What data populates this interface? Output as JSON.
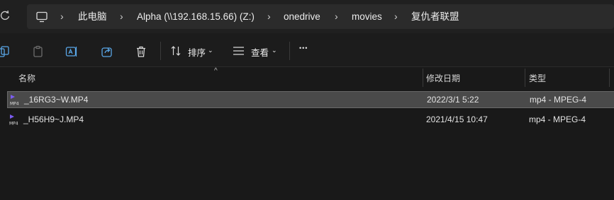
{
  "breadcrumbs": [
    "此电脑",
    "Alpha (\\\\192.168.15.66) (Z:)",
    "onedrive",
    "movies",
    "复仇者联盟"
  ],
  "toolbar": {
    "sort_label": "排序",
    "view_label": "查看",
    "more_label": "•••"
  },
  "columns": {
    "name": "名称",
    "modified": "修改日期",
    "type": "类型"
  },
  "files": [
    {
      "name": "_16RG3~W.MP4",
      "modified": "2022/3/1 5:22",
      "type": "mp4 - MPEG-4",
      "selected": true
    },
    {
      "name": "_H56H9~J.MP4",
      "modified": "2021/4/15 10:47",
      "type": "mp4 - MPEG-4",
      "selected": false
    }
  ],
  "colors": {
    "background": "#191919",
    "address_bar": "#2b2b2b",
    "selection": "#4a4a4a",
    "mp4_icon": "#5b3fd0"
  },
  "icons": [
    "refresh-icon",
    "computer-icon",
    "chevron-right-icon",
    "copy-icon",
    "paste-icon",
    "rename-icon",
    "share-icon",
    "delete-icon",
    "sort-icon",
    "view-icon",
    "chevron-down-icon",
    "more-icon",
    "mp4-file-icon"
  ]
}
